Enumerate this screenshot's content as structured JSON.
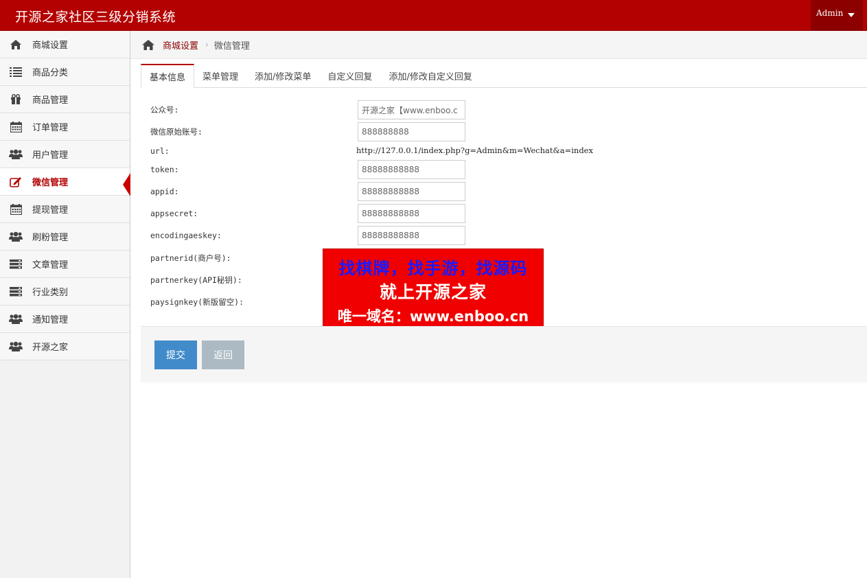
{
  "app": {
    "title": "开源之家社区三级分销系统",
    "user": "Admin"
  },
  "colors": {
    "brand": "#b30000",
    "active_indicator": "#c80000",
    "submit_button": "#428bca",
    "back_button": "#abbac3"
  },
  "sidebar": {
    "items": [
      {
        "label": "商城设置",
        "icon": "home-icon"
      },
      {
        "label": "商品分类",
        "icon": "list-icon"
      },
      {
        "label": "商品管理",
        "icon": "gift-icon"
      },
      {
        "label": "订单管理",
        "icon": "calendar-icon"
      },
      {
        "label": "用户管理",
        "icon": "users-icon"
      },
      {
        "label": "微信管理",
        "icon": "edit-icon",
        "active": true
      },
      {
        "label": "提现管理",
        "icon": "calendar-icon"
      },
      {
        "label": "刷粉管理",
        "icon": "users-icon"
      },
      {
        "label": "文章管理",
        "icon": "server-icon"
      },
      {
        "label": "行业类别",
        "icon": "server-icon"
      },
      {
        "label": "通知管理",
        "icon": "users-icon"
      },
      {
        "label": "开源之家",
        "icon": "users-icon"
      }
    ]
  },
  "breadcrumb": {
    "link": "商城设置",
    "separator": "›",
    "current": "微信管理"
  },
  "tabs": [
    {
      "label": "基本信息",
      "active": true
    },
    {
      "label": "菜单管理"
    },
    {
      "label": "添加/修改菜单"
    },
    {
      "label": "自定义回复"
    },
    {
      "label": "添加/修改自定义回复"
    }
  ],
  "form": {
    "account_label": "公众号:",
    "account_value": "开源之家【www.enboo.c",
    "original_id_label": "微信原始账号:",
    "original_id_value": "888888888",
    "url_label": "url:",
    "url_value": "http://127.0.0.1/index.php?g=Admin&m=Wechat&a=index",
    "token_label": "token:",
    "token_value": "88888888888",
    "appid_label": "appid:",
    "appid_value": "88888888888",
    "appsecret_label": "appsecret:",
    "appsecret_value": "88888888888",
    "encodingaeskey_label": "encodingaeskey:",
    "encodingaeskey_value": "88888888888",
    "partnerid_label": "partnerid(商户号):",
    "partnerkey_label": "partnerkey(API秘钥):",
    "paysignkey_label": "paysignkey(新版留空):"
  },
  "promo": {
    "line1": "找棋牌，找手游，找源码",
    "line2": "就上开源之家",
    "line3": "唯一域名：www.enboo.cn"
  },
  "actions": {
    "submit_label": "提交",
    "back_label": "返回"
  }
}
